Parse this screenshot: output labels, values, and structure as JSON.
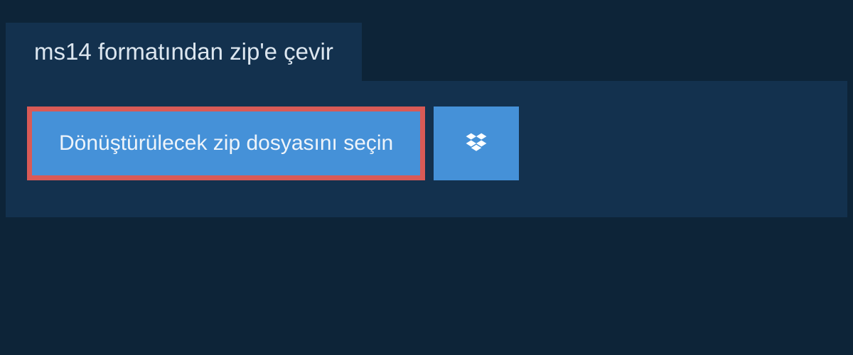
{
  "header": {
    "title": "ms14 formatından zip'e çevir"
  },
  "main": {
    "file_button_label": "Dönüştürülecek zip dosyasını seçin"
  },
  "colors": {
    "page_bg": "#0d2438",
    "panel_bg": "#13314e",
    "button_bg": "#4591d8",
    "button_border": "#d95a56",
    "text_light": "#dce6ef"
  }
}
